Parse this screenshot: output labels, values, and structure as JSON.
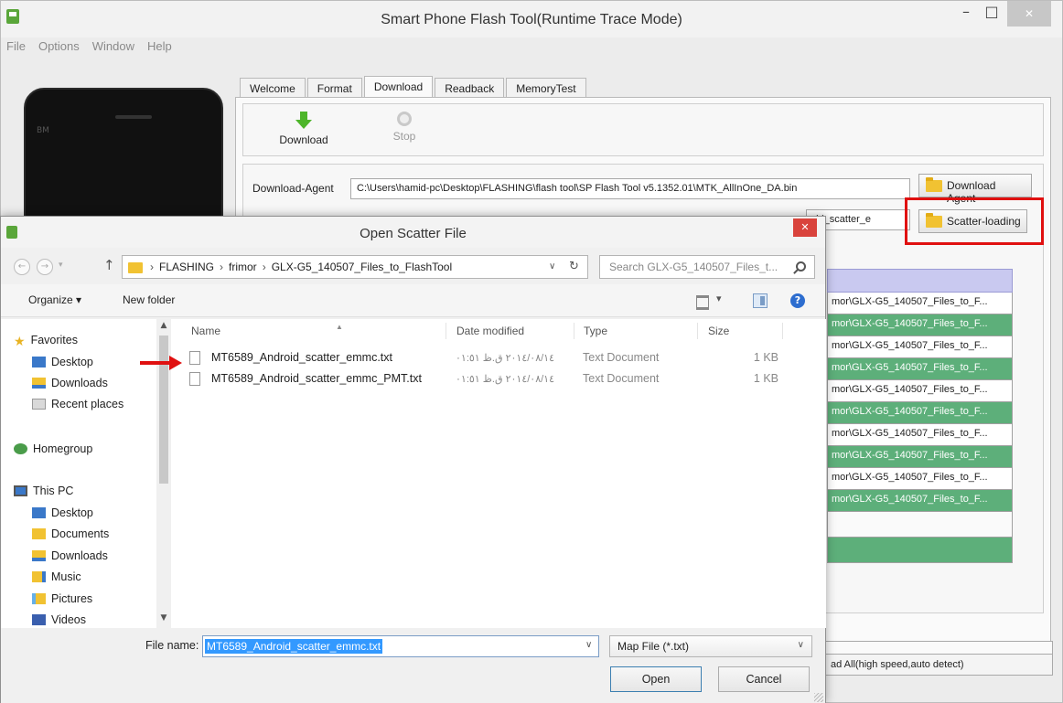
{
  "main_window": {
    "title": "Smart Phone Flash Tool(Runtime Trace Mode)",
    "menu": [
      "File",
      "Options",
      "Window",
      "Help"
    ],
    "phone_brand": "BM",
    "tabs": [
      "Welcome",
      "Format",
      "Download",
      "Readback",
      "MemoryTest"
    ],
    "active_tab": "Download",
    "toolbar": {
      "download_label": "Download",
      "stop_label": "Stop"
    },
    "download_agent_label": "Download-Agent",
    "download_agent_path": "C:\\Users\\hamid-pc\\Desktop\\FLASHING\\flash tool\\SP Flash Tool v5.1352.01\\MTK_AllInOne_DA.bin",
    "scatter_path_fragment": "oid_scatter_e",
    "download_agent_button": "Download Agent",
    "scatter_loading_button": "Scatter-loading",
    "partition_rows": [
      "mor\\GLX-G5_140507_Files_to_F...",
      "mor\\GLX-G5_140507_Files_to_F...",
      "mor\\GLX-G5_140507_Files_to_F...",
      "mor\\GLX-G5_140507_Files_to_F...",
      "mor\\GLX-G5_140507_Files_to_F...",
      "mor\\GLX-G5_140507_Files_to_F...",
      "mor\\GLX-G5_140507_Files_to_F...",
      "mor\\GLX-G5_140507_Files_to_F...",
      "mor\\GLX-G5_140507_Files_to_F...",
      "mor\\GLX-G5_140507_Files_to_F..."
    ],
    "download_mode": "ad All(high speed,auto detect)"
  },
  "dialog": {
    "title": "Open Scatter File",
    "breadcrumb": [
      "FLASHING",
      "frimor",
      "GLX-G5_140507_Files_to_FlashTool"
    ],
    "search_placeholder": "Search GLX-G5_140507_Files_t...",
    "organize_label": "Organize ▾",
    "new_folder_label": "New folder",
    "nav": {
      "favorites": "Favorites",
      "desktop": "Desktop",
      "downloads": "Downloads",
      "recent_places": "Recent places",
      "homegroup": "Homegroup",
      "this_pc": "This PC",
      "pc_desktop": "Desktop",
      "documents": "Documents",
      "pc_downloads": "Downloads",
      "music": "Music",
      "pictures": "Pictures",
      "videos": "Videos"
    },
    "columns": {
      "name": "Name",
      "date": "Date modified",
      "type": "Type",
      "size": "Size"
    },
    "files": [
      {
        "name": "MT6589_Android_scatter_emmc.txt",
        "date": "٢٠١٤/٠٨/١٤ ق.ظ ٠١:٥١",
        "type": "Text Document",
        "size": "1 KB"
      },
      {
        "name": "MT6589_Android_scatter_emmc_PMT.txt",
        "date": "٢٠١٤/٠٨/١٤ ق.ظ ٠١:٥١",
        "type": "Text Document",
        "size": "1 KB"
      }
    ],
    "file_name_label": "File name:",
    "file_name_value": "MT6589_Android_scatter_emmc.txt",
    "file_type": "Map File (*.txt)",
    "open_label": "Open",
    "cancel_label": "Cancel"
  },
  "colors": {
    "green_row": "#5daf7a",
    "highlight_red": "#e01010",
    "selection_blue": "#3399ff"
  }
}
